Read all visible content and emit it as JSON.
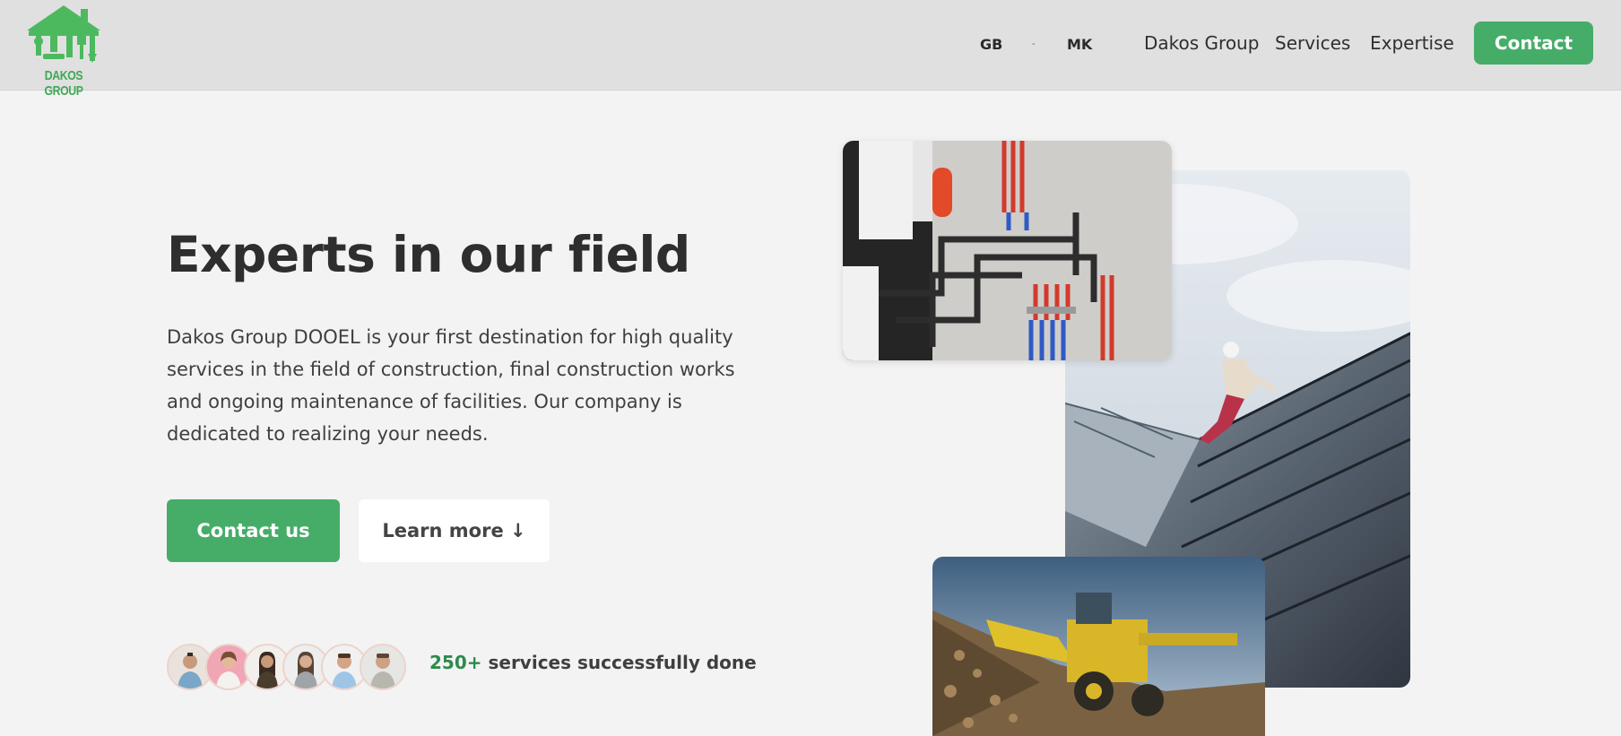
{
  "header": {
    "logo_text": "DAKOS GROUP",
    "lang": {
      "gb": "GB",
      "separator": "-",
      "mk": "MK"
    },
    "nav": {
      "dakos_group": "Dakos Group",
      "services": "Services",
      "expertise": "Expertise",
      "contact": "Contact"
    }
  },
  "hero": {
    "title": "Experts in our field",
    "description": "Dakos Group DOOEL is your first destination for high quality services in the field of construction, final construction works and ongoing maintenance of facilities. Our company is dedicated to realizing your needs.",
    "primary_button": "Contact us",
    "secondary_button": "Learn more ↓",
    "stats_number": "250+",
    "stats_text": " services successfully done"
  },
  "colors": {
    "accent": "#46ad69",
    "stats_green": "#2d8a4c",
    "header_bg": "#e0e0e0",
    "page_bg": "#f3f3f3"
  },
  "icons": {
    "logo": "house-tools-logo",
    "learn_more_arrow": "arrow-down"
  }
}
